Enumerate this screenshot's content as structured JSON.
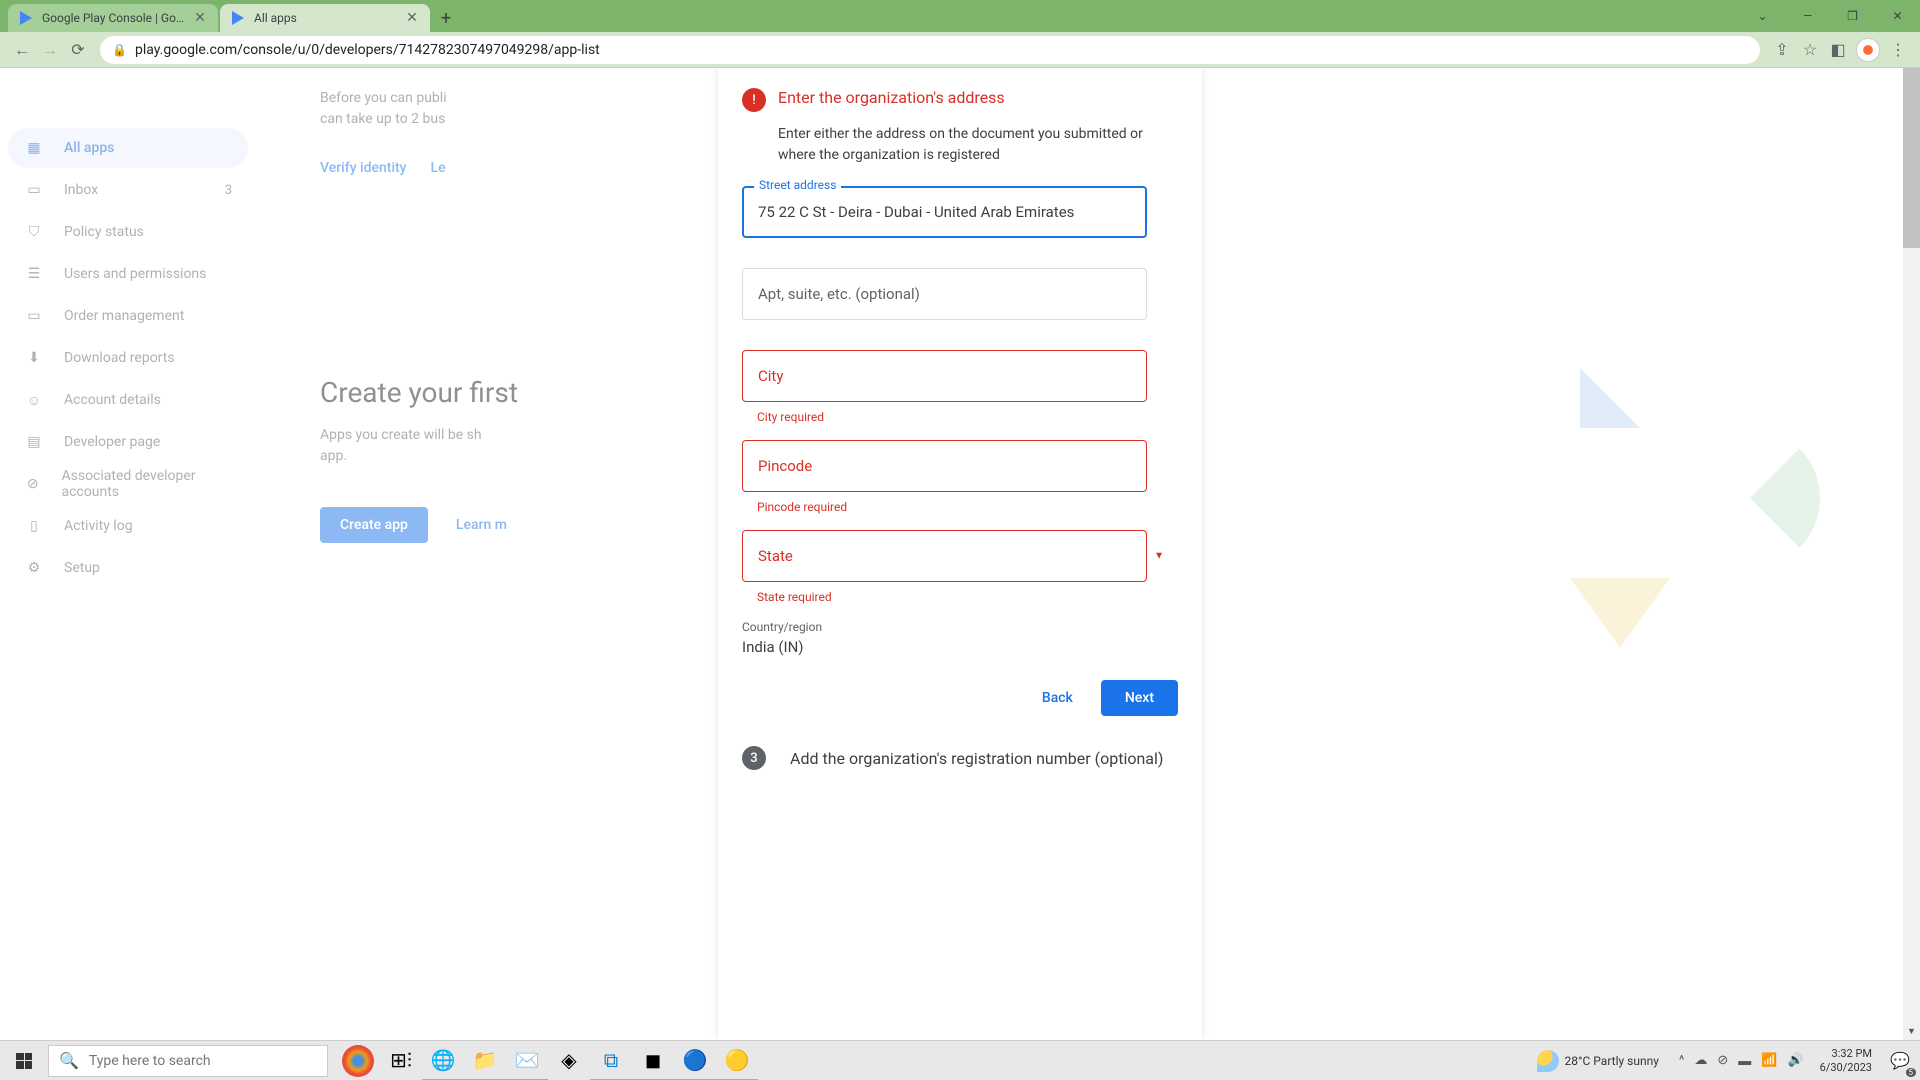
{
  "browser": {
    "tabs": [
      {
        "title": "Google Play Console | Google Pl",
        "active": false
      },
      {
        "title": "All apps",
        "active": true
      }
    ],
    "url": "play.google.com/console/u/0/developers/7142782307497049298/app-list",
    "window_controls": {
      "min": "—",
      "max": "❐",
      "close": "✕"
    }
  },
  "sidebar": {
    "items": [
      {
        "label": "All apps",
        "icon": "grid",
        "active": true
      },
      {
        "label": "Inbox",
        "icon": "inbox",
        "badge": "3"
      },
      {
        "label": "Policy status",
        "icon": "shield"
      },
      {
        "label": "Users and permissions",
        "icon": "users"
      },
      {
        "label": "Order management",
        "icon": "card"
      },
      {
        "label": "Download reports",
        "icon": "download",
        "expandable": true
      },
      {
        "label": "Account details",
        "icon": "person"
      },
      {
        "label": "Developer page",
        "icon": "page"
      },
      {
        "label": "Associated developer accounts",
        "icon": "link"
      },
      {
        "label": "Activity log",
        "icon": "log"
      },
      {
        "label": "Setup",
        "icon": "gear",
        "expandable": true
      }
    ]
  },
  "backpage": {
    "hint1": "Before you can publi",
    "hint2": "can take up to 2 bus",
    "verify": "Verify identity",
    "le": "Le",
    "title": "Create your first",
    "sub1": "Apps you create will be sh",
    "sub2": "app.",
    "create_btn": "Create app",
    "learn": "Learn m"
  },
  "modal": {
    "step2_title": "Enter the organization's address",
    "step2_desc": "Enter either the address on the document you submitted or where the organization is registered",
    "street_label": "Street address",
    "street_value": "75 22 C St - Deira - Dubai - United Arab Emirates",
    "apt_placeholder": "Apt, suite, etc. (optional)",
    "city_placeholder": "City",
    "city_error": "City required",
    "pincode_placeholder": "Pincode",
    "pincode_error": "Pincode required",
    "state_placeholder": "State",
    "state_error": "State required",
    "country_label": "Country/region",
    "country_value": "India (IN)",
    "back_btn": "Back",
    "next_btn": "Next",
    "step3_title": "Add the organization's registration number (optional)",
    "step3_num": "3"
  },
  "taskbar": {
    "search_placeholder": "Type here to search",
    "weather_temp": "28°C",
    "weather_desc": "Partly sunny",
    "time": "3:32 PM",
    "date": "6/30/2023",
    "notif_count": "5"
  }
}
